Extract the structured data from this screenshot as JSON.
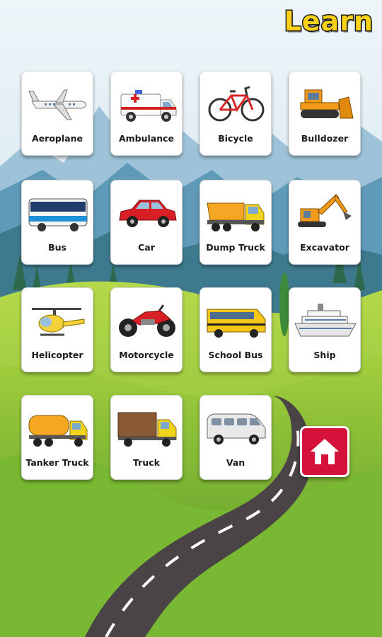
{
  "header": {
    "title": "Learn"
  },
  "vehicles": [
    {
      "label": "Aeroplane",
      "icon": "aeroplane-icon"
    },
    {
      "label": "Ambulance",
      "icon": "ambulance-icon"
    },
    {
      "label": "Bicycle",
      "icon": "bicycle-icon"
    },
    {
      "label": "Bulldozer",
      "icon": "bulldozer-icon"
    },
    {
      "label": "Bus",
      "icon": "bus-icon"
    },
    {
      "label": "Car",
      "icon": "car-icon"
    },
    {
      "label": "Dump Truck",
      "icon": "dump-truck-icon"
    },
    {
      "label": "Excavator",
      "icon": "excavator-icon"
    },
    {
      "label": "Helicopter",
      "icon": "helicopter-icon"
    },
    {
      "label": "Motorcycle",
      "icon": "motorcycle-icon"
    },
    {
      "label": "School Bus",
      "icon": "school-bus-icon"
    },
    {
      "label": "Ship",
      "icon": "ship-icon"
    },
    {
      "label": "Tanker Truck",
      "icon": "tanker-truck-icon"
    },
    {
      "label": "Truck",
      "icon": "truck-icon"
    },
    {
      "label": "Van",
      "icon": "van-icon"
    }
  ],
  "home_button": {
    "icon": "home-icon",
    "color": "#d4123a"
  },
  "colors": {
    "title_fill": "#ffd21a",
    "title_stroke": "#1b1b1b",
    "sky": "#cfe3ef",
    "grass": "#8fc63e",
    "road": "#4a4446"
  }
}
